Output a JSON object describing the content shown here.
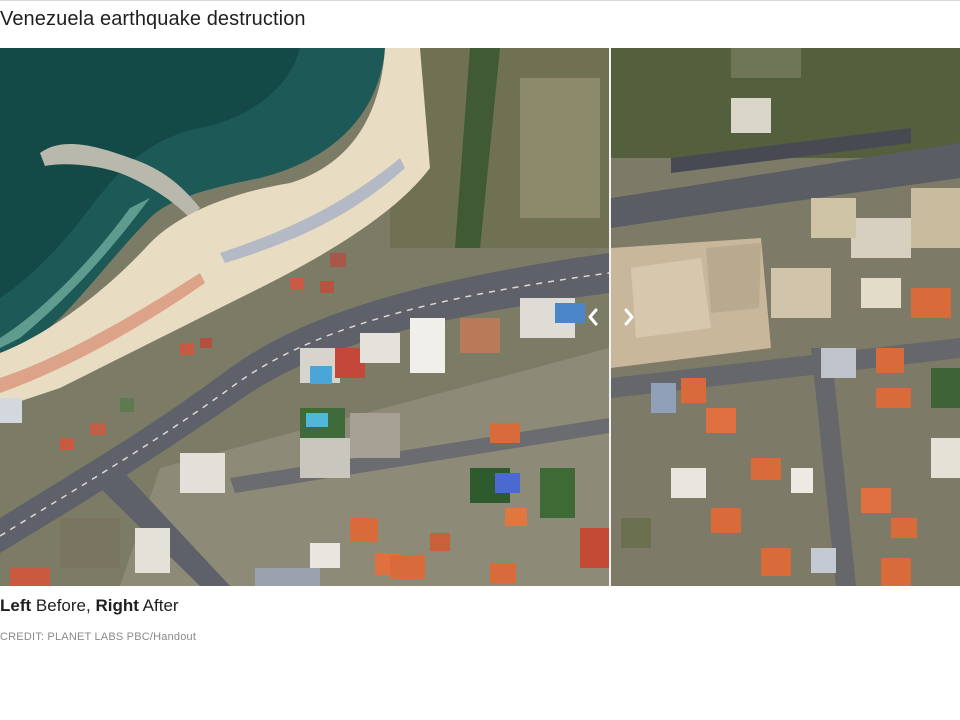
{
  "title": "Venezuela earthquake destruction",
  "caption": {
    "left_word": "Left",
    "left_text": " Before, ",
    "right_word": "Right",
    "right_text": " After"
  },
  "credit": "CREDIT: PLANET LABS PBC/Handout",
  "slider": {
    "position": 0.635,
    "left_arrow_icon": "chevron-left-icon",
    "right_arrow_icon": "chevron-right-icon"
  },
  "colors": {
    "sea": "#1d5a57",
    "sand": "#e8dcc2",
    "road": "#5e6169",
    "roof": "#d96b3a",
    "rubble": "#c8b79a"
  }
}
